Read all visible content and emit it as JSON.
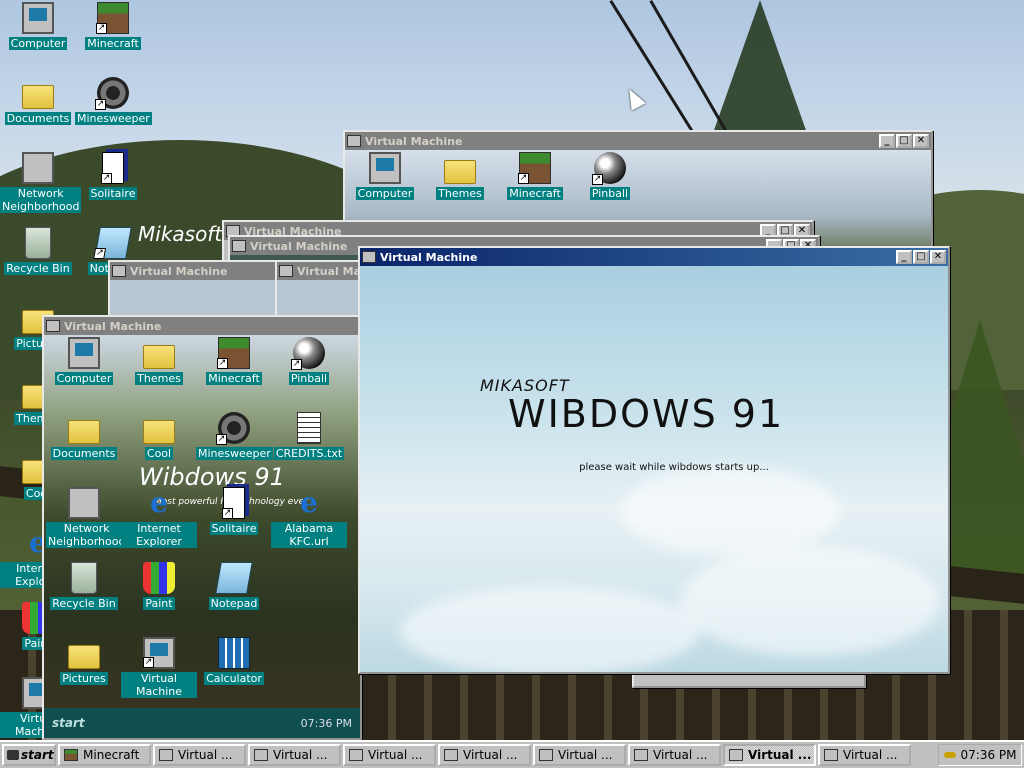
{
  "desktop": {
    "icons": [
      {
        "label": "Computer",
        "icon": "computer-icon"
      },
      {
        "label": "Minecraft",
        "icon": "minecraft-icon"
      },
      {
        "label": "Documents",
        "icon": "documents-folder-icon"
      },
      {
        "label": "Minesweeper",
        "icon": "minesweeper-icon"
      },
      {
        "label": "Network Neighborhood",
        "icon": "network-icon"
      },
      {
        "label": "Solitaire",
        "icon": "solitaire-icon"
      },
      {
        "label": "Recycle Bin",
        "icon": "recycle-bin-icon"
      },
      {
        "label": "Notepad",
        "icon": "notepad-icon"
      },
      {
        "label": "Pictures",
        "icon": "pictures-folder-icon"
      },
      {
        "label": "Themes",
        "icon": "themes-folder-icon"
      },
      {
        "label": "Cool",
        "icon": "cool-folder-icon"
      },
      {
        "label": "Internet Explorer",
        "icon": "ie-icon"
      },
      {
        "label": "Paint",
        "icon": "paint-icon"
      },
      {
        "label": "Virtual Machine",
        "icon": "vm-icon"
      }
    ],
    "watermark_brand": "Mikasoft"
  },
  "vm_top": {
    "title": "Virtual Machine",
    "icons": [
      "Computer",
      "Themes",
      "Minecraft",
      "Pinball"
    ]
  },
  "vm_stack_title": "Virtual Machine",
  "vm_front_left": {
    "title": "Virtual Machine",
    "icons": [
      "Computer",
      "Themes",
      "Minecraft",
      "Pinball",
      "Documents",
      "Cool",
      "Minesweeper",
      "CREDITS.txt",
      "Network Neighborhood",
      "Internet Explorer",
      "Solitaire",
      "Alabama KFC.url",
      "Recycle Bin",
      "Paint",
      "Notepad",
      "Pictures",
      "Virtual Machine",
      "Calculator"
    ],
    "watermark_title": "Wibdows 91",
    "watermark_sub": "Most powerful PC technology ever",
    "taskbar_start": "start",
    "taskbar_clock": "07:36 PM"
  },
  "splash_window": {
    "title": "Virtual Machine",
    "brand": "MIKASOFT",
    "product": "WIBDOWS 91",
    "message": "please wait while wibdows starts up..."
  },
  "taskbar": {
    "start_label": "start",
    "tasks": [
      {
        "label": "Minecraft",
        "active": false,
        "icon": "minecraft-icon"
      },
      {
        "label": "Virtual ...",
        "active": false,
        "icon": "vm-icon"
      },
      {
        "label": "Virtual ...",
        "active": false,
        "icon": "vm-icon"
      },
      {
        "label": "Virtual ...",
        "active": false,
        "icon": "vm-icon"
      },
      {
        "label": "Virtual ...",
        "active": false,
        "icon": "vm-icon"
      },
      {
        "label": "Virtual ...",
        "active": false,
        "icon": "vm-icon"
      },
      {
        "label": "Virtual ...",
        "active": false,
        "icon": "vm-icon"
      },
      {
        "label": "Virtual ...",
        "active": true,
        "icon": "vm-icon"
      },
      {
        "label": "Virtual ...",
        "active": false,
        "icon": "vm-icon"
      }
    ],
    "clock": "07:36 PM"
  },
  "colors": {
    "desktop_teal": "#008080",
    "active_title": "#0a246a",
    "inactive_title": "#808080",
    "chrome": "#c0c0c0"
  }
}
